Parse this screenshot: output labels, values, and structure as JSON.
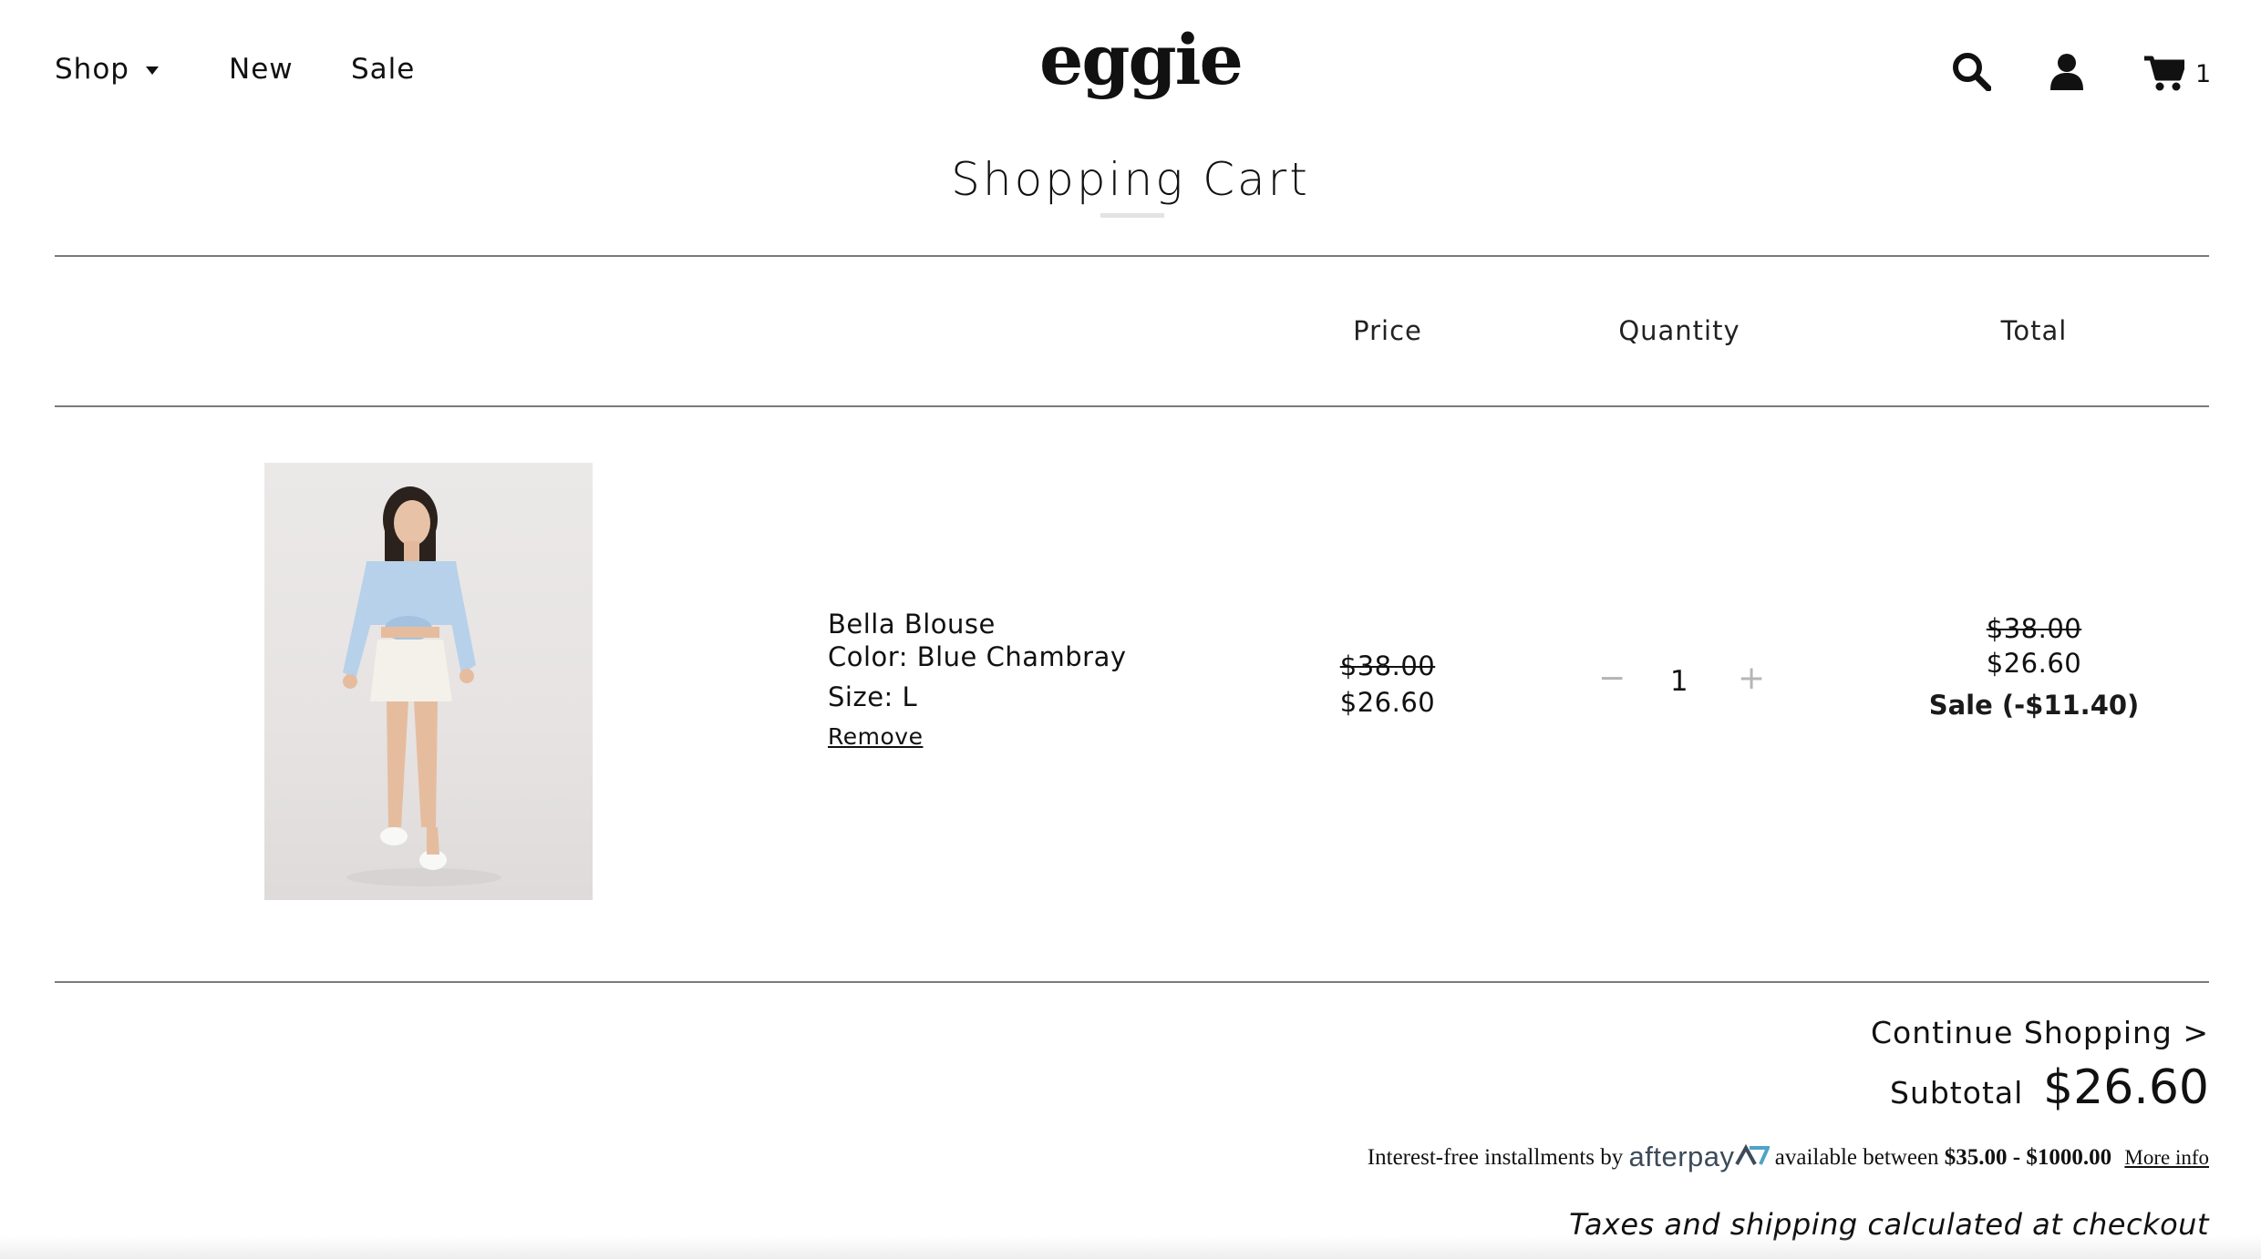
{
  "header": {
    "nav": {
      "shop_label": "Shop",
      "new_label": "New",
      "sale_label": "Sale"
    },
    "logo_text": "eggie",
    "cart_count": "1",
    "icons": [
      "search-icon",
      "account-icon",
      "cart-icon"
    ]
  },
  "page_title": "Shopping Cart",
  "table": {
    "headers": {
      "price": "Price",
      "quantity": "Quantity",
      "total": "Total"
    }
  },
  "cart_items": [
    {
      "name": "Bella Blouse",
      "color": "Color: Blue Chambray",
      "size": "Size: L",
      "remove_label": "Remove",
      "price_original": "$38.00",
      "price_sale": "$26.60",
      "quantity": "1",
      "qty_minus": "−",
      "qty_plus": "+",
      "total_original": "$38.00",
      "total_sale": "$26.60",
      "discount_label": "Sale (-$11.40)"
    }
  ],
  "summary": {
    "continue_label": "Continue Shopping >",
    "subtotal_label": "Subtotal",
    "subtotal_value": "$26.60",
    "afterpay": {
      "prefix": "Interest-free installments by",
      "brand": "afterpay",
      "middle": "available between",
      "range": "$35.00 - $1000.00",
      "more_info": "More info"
    },
    "taxes_note": "Taxes and shipping calculated at checkout"
  },
  "colors": {
    "text": "#111111",
    "rule": "#7a7a7a",
    "muted_button": "#b5b5b5",
    "afterpay_brand": "#3d4a59",
    "afterpay_accent": "#4fa3c6",
    "blouse": "#b7d1ea",
    "skirt": "#f4f1ea"
  }
}
